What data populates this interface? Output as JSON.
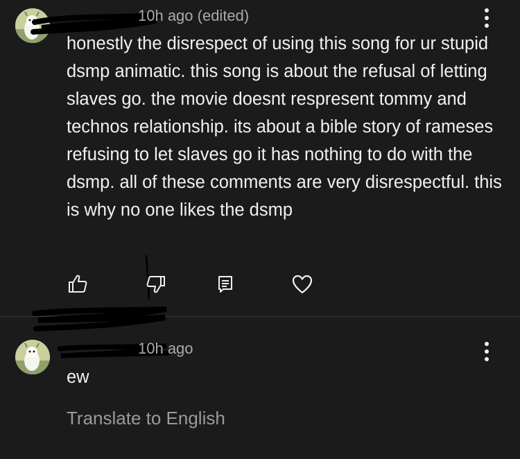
{
  "comments": [
    {
      "timestamp": "10h ago (edited)",
      "text": "honestly the disrespect of using this song for ur stupid dsmp animatic. this song is about the refusal of letting slaves go. the movie doesnt respresent tommy and technos relationship. its about a bible story of rameses refusing to let slaves go it has nothing to do with the dsmp. all of these comments are very disrespectful. this is why no one likes the dsmp",
      "actions": {
        "like_icon": "thumbs-up-icon",
        "dislike_icon": "thumbs-down-icon",
        "reply_icon": "reply-icon",
        "heart_icon": "heart-icon"
      },
      "menu_icon": "more-vert-icon"
    },
    {
      "timestamp": "10h ago",
      "text": "ew",
      "menu_icon": "more-vert-icon",
      "translate_label": "Translate to English"
    }
  ],
  "colors": {
    "background": "#1b1b1b",
    "text": "#f1f1f1",
    "secondary_text": "#aaaaaa",
    "redaction": "#000000",
    "avatar": "#cfd3a8"
  }
}
